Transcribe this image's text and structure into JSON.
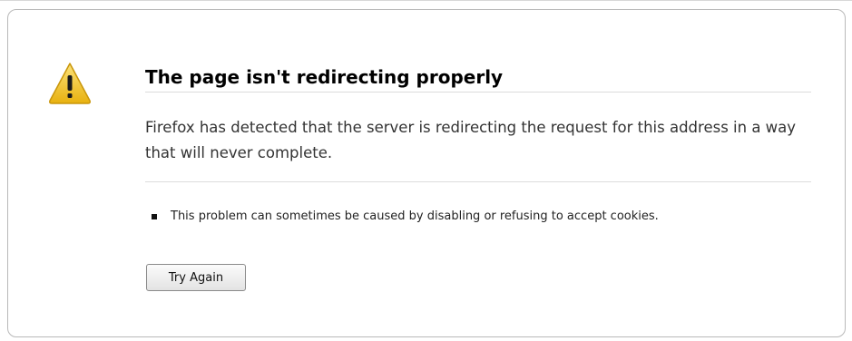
{
  "error": {
    "title": "The page isn't redirecting properly",
    "description": "Firefox has detected that the server is redirecting the request for this address in a way that will never complete.",
    "hints": [
      "This problem can sometimes be caused by disabling or refusing to accept cookies."
    ],
    "icon": "warning-icon",
    "try_again_label": "Try Again"
  },
  "colors": {
    "warning_yellow": "#f2c21a",
    "border": "#b9b9b9",
    "rule": "#dcdcdc"
  }
}
